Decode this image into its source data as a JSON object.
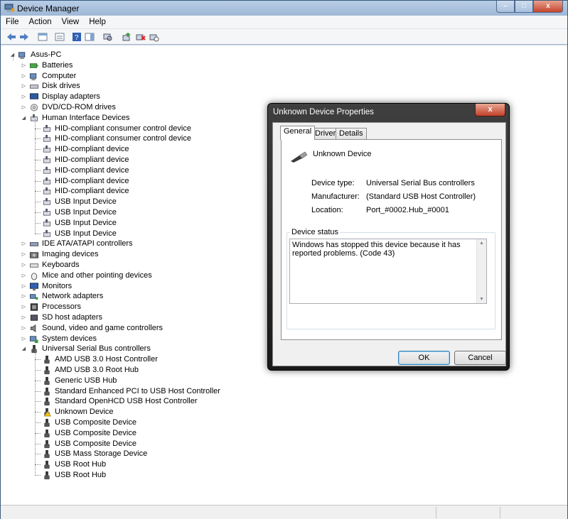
{
  "window": {
    "title": "Device Manager",
    "min": "–",
    "max": "□",
    "close": "x"
  },
  "menu": [
    "File",
    "Action",
    "View",
    "Help"
  ],
  "tree": {
    "root": "Asus-PC",
    "categories": [
      "Batteries",
      "Computer",
      "Disk drives",
      "Display adapters",
      "DVD/CD-ROM drives",
      "Human Interface Devices",
      "IDE ATA/ATAPI controllers",
      "Imaging devices",
      "Keyboards",
      "Mice and other pointing devices",
      "Monitors",
      "Network adapters",
      "Processors",
      "SD host adapters",
      "Sound, video and game controllers",
      "System devices",
      "Universal Serial Bus controllers"
    ],
    "hid_devices": [
      "HID-compliant consumer control device",
      "HID-compliant consumer control device",
      "HID-compliant device",
      "HID-compliant device",
      "HID-compliant device",
      "HID-compliant device",
      "HID-compliant device",
      "USB Input Device",
      "USB Input Device",
      "USB Input Device",
      "USB Input Device"
    ],
    "usb_devices": [
      "AMD USB 3.0 Host Controller",
      "AMD USB 3.0 Root Hub",
      "Generic USB Hub",
      "Standard Enhanced PCI to USB Host Controller",
      "Standard OpenHCD USB Host Controller",
      "Unknown Device",
      "USB Composite Device",
      "USB Composite Device",
      "USB Composite Device",
      "USB Mass Storage Device",
      "USB Root Hub",
      "USB Root Hub"
    ]
  },
  "dialog": {
    "title": "Unknown Device Properties",
    "close": "x",
    "tabs": [
      "General",
      "Driver",
      "Details"
    ],
    "device_name": "Unknown Device",
    "fields": [
      {
        "label": "Device type:",
        "value": "Universal Serial Bus controllers"
      },
      {
        "label": "Manufacturer:",
        "value": "(Standard USB Host Controller)"
      },
      {
        "label": "Location:",
        "value": "Port_#0002.Hub_#0001"
      }
    ],
    "status_legend": "Device status",
    "status_text": "Windows has stopped this device because it has reported problems. (Code 43)",
    "ok": "OK",
    "cancel": "Cancel"
  }
}
